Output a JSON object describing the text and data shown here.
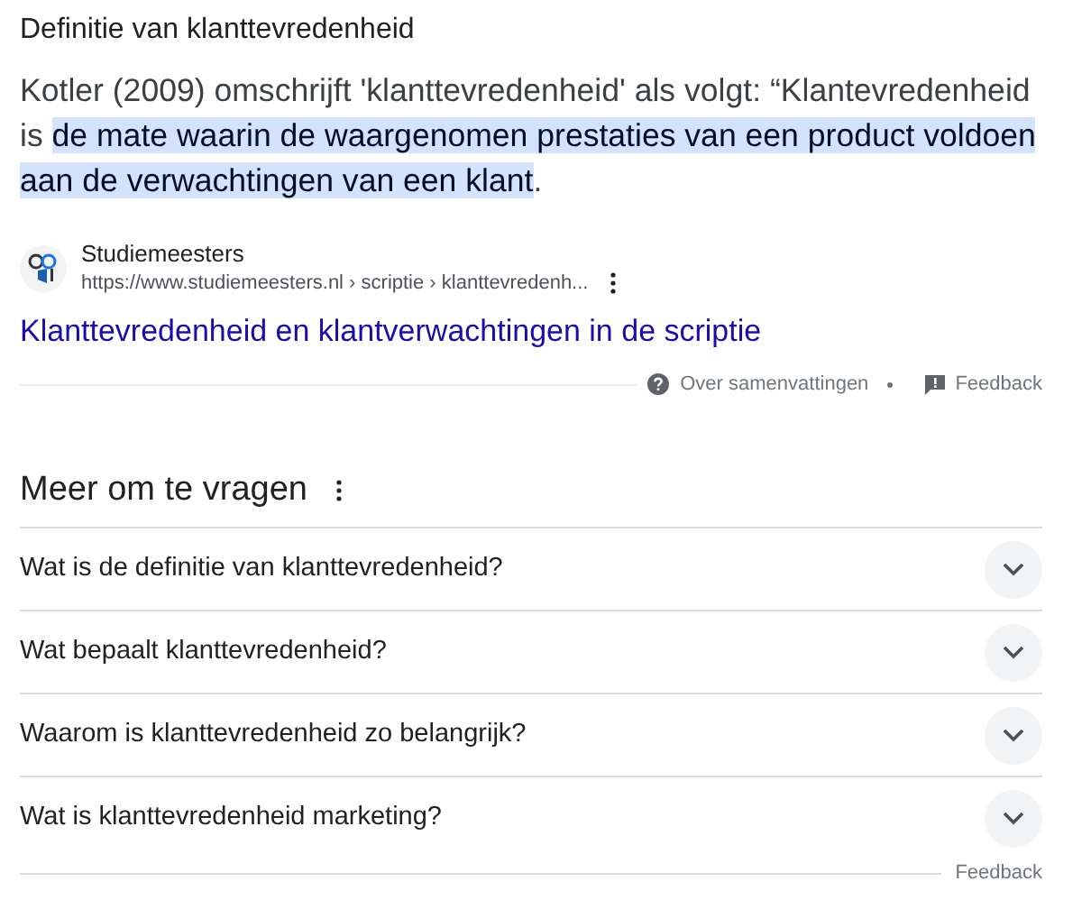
{
  "snippet": {
    "title": "Definitie van klanttevredenheid",
    "text": "Kotler (2009) omschrijft 'klanttevredenheid' als volgt: “Klantevredenheid is **de mate waarin de waargenomen prestaties van een product voldoen aan de verwachtingen van een klant**."
  },
  "source": {
    "name": "Studiemeesters",
    "url": "https://www.studiemeesters.nl › scriptie › klanttevredenh...",
    "link": "Klanttevredenheid en klantverwachtingen in de scriptie"
  },
  "footer": {
    "about": "Over samenvattingen",
    "feedback": "Feedback"
  },
  "related": {
    "heading": "Meer om te vragen",
    "questions": [
      {
        "text": "Wat is de definitie van klanttevredenheid?",
        "expanded": false
      },
      {
        "text": "Wat bepaalt klanttevredenheid?",
        "expanded": false
      },
      {
        "text": "Waarom is klanttevredenheid zo belangrijk?",
        "expanded": false
      },
      {
        "text": "Wat is klanttevredenheid marketing?",
        "expanded": false
      }
    ],
    "feedback": "Feedback"
  }
}
